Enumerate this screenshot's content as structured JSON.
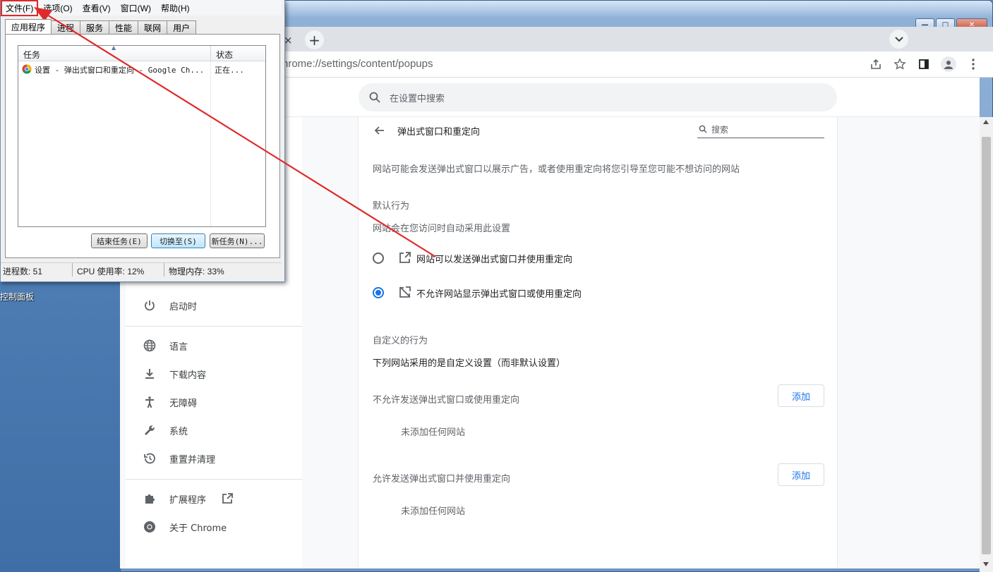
{
  "desktop": {
    "icon_label": "控制面板"
  },
  "chrome": {
    "tab_close": "×",
    "new_tab": "+",
    "window_controls": {
      "minimize": "—",
      "maximize": "□",
      "close": "✕"
    },
    "url_host": "chrome://settings",
    "url_path": "/content/popups",
    "url_display": "hrome://settings/content/popups",
    "search_placeholder": "在设置中搜索",
    "sidebar": {
      "items": [
        {
          "label": "启动时",
          "icon": "power-icon"
        },
        {
          "label": "语言",
          "icon": "globe-icon"
        },
        {
          "label": "下载内容",
          "icon": "download-icon"
        },
        {
          "label": "无障碍",
          "icon": "accessibility-icon"
        },
        {
          "label": "系统",
          "icon": "wrench-icon"
        },
        {
          "label": "重置并清理",
          "icon": "history-icon"
        },
        {
          "label": "扩展程序",
          "icon": "puzzle-icon"
        },
        {
          "label": "关于 Chrome",
          "icon": "chrome-icon"
        }
      ]
    },
    "popups": {
      "title": "弹出式窗口和重定向",
      "search_placeholder": "搜索",
      "description": "网站可能会发送弹出式窗口以展示广告，或者使用重定向将您引导至您可能不想访问的网站",
      "default_heading": "默认行为",
      "default_sub": "网站会在您访问时自动采用此设置",
      "option_allow": "网站可以发送弹出式窗口并使用重定向",
      "option_block": "不允许网站显示弹出式窗口或使用重定向",
      "selected": "block",
      "custom_heading": "自定义的行为",
      "custom_sub": "下列网站采用的是自定义设置（而非默认设置）",
      "block_list_heading": "不允许发送弹出式窗口或使用重定向",
      "allow_list_heading": "允许发送弹出式窗口并使用重定向",
      "add_label": "添加",
      "empty_label": "未添加任何网站"
    },
    "accent": "#1a73e8"
  },
  "taskmgr": {
    "menus": [
      "文件(F)",
      "选项(O)",
      "查看(V)",
      "窗口(W)",
      "帮助(H)"
    ],
    "tabs": [
      "应用程序",
      "进程",
      "服务",
      "性能",
      "联网",
      "用户"
    ],
    "columns": {
      "task": "任务",
      "status": "状态"
    },
    "rows": [
      {
        "task": "设置 - 弹出式窗口和重定向 - Google Ch...",
        "status": "正在..."
      }
    ],
    "buttons": {
      "end": "结束任务(E)",
      "switch": "切换至(S)",
      "new": "新任务(N)..."
    },
    "status": {
      "processes": "进程数: 51",
      "cpu": "CPU 使用率: 12%",
      "memory": "物理内存: 33%"
    }
  },
  "annotation_color": "#e0292a"
}
